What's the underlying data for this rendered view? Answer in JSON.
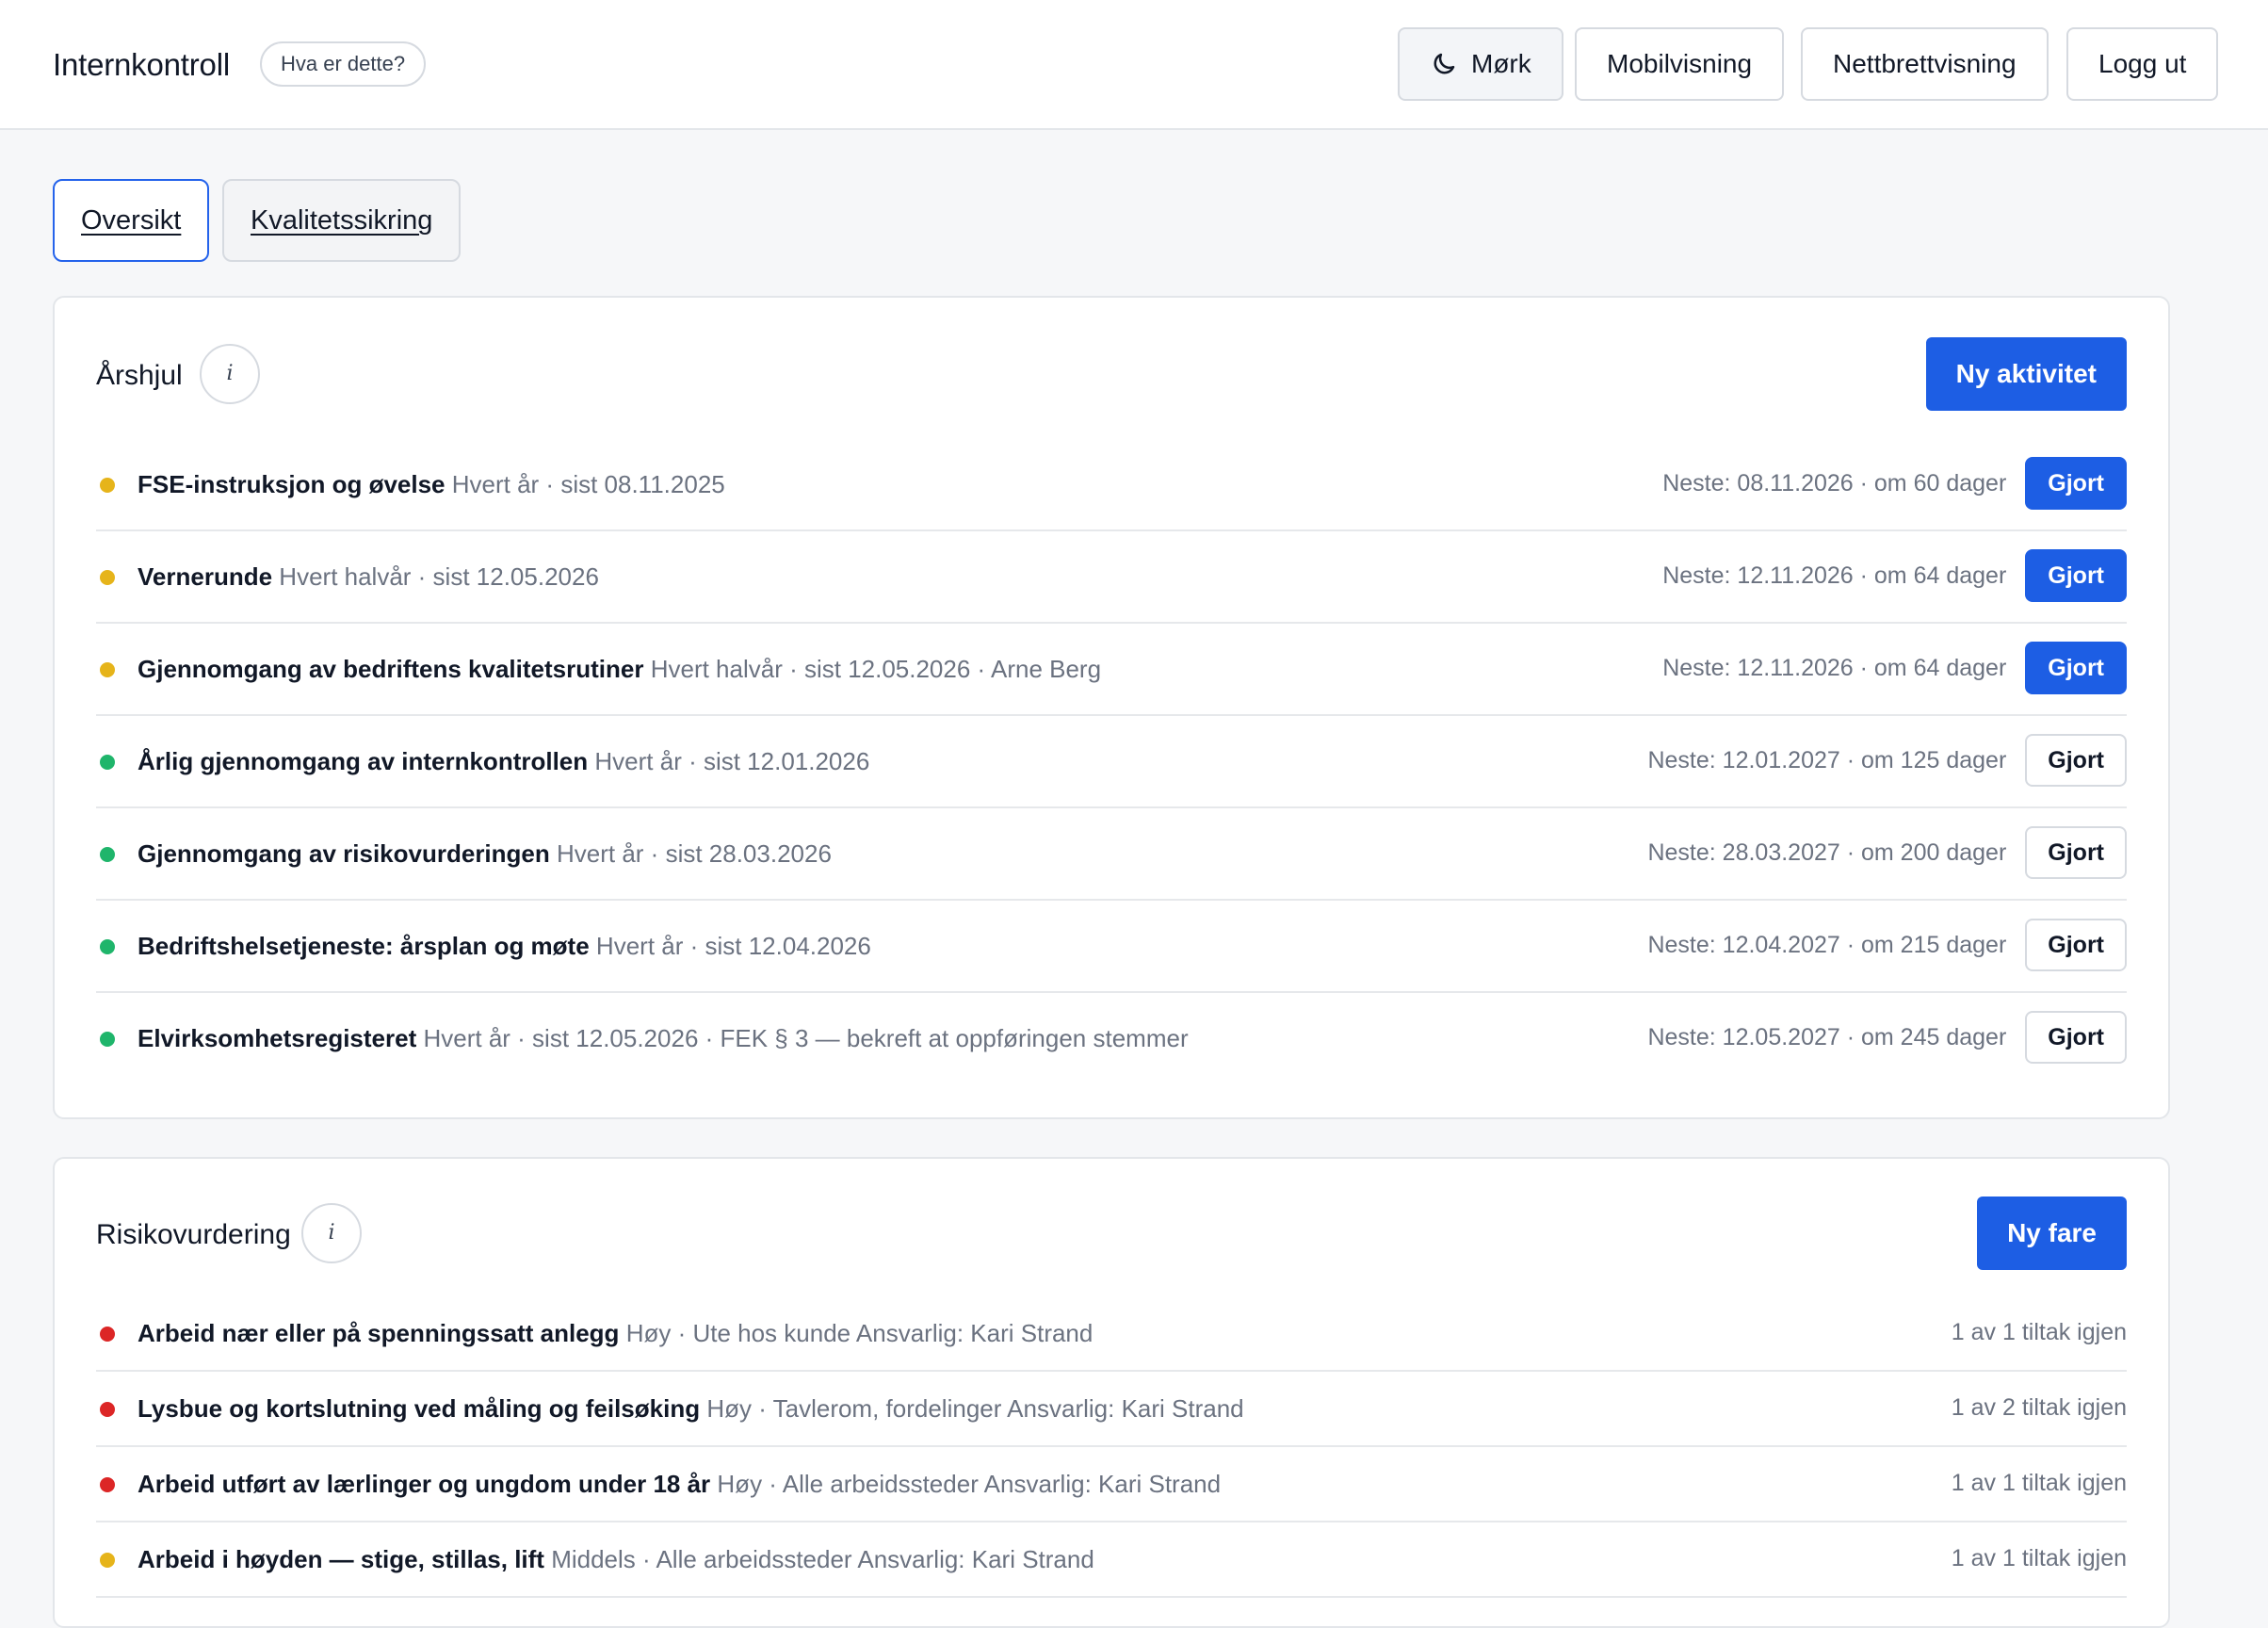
{
  "header": {
    "brand": "Internkontroll",
    "help_label": "Hva er dette?",
    "dark_label": "Mørk",
    "mobile_label": "Mobilvisning",
    "tablet_label": "Nettbrettvisning",
    "logout_label": "Logg ut"
  },
  "tabs": [
    {
      "label": "Oversikt",
      "active": true
    },
    {
      "label": "Kvalitetssikring",
      "active": false
    }
  ],
  "colors": {
    "accent": "#1d5ee4",
    "status_yellow": "#e6b41a",
    "status_green": "#1fb56b",
    "status_red": "#dc2626"
  },
  "arshjul": {
    "title": "Årshjul",
    "info_label": "i",
    "new_label": "Ny aktivitet",
    "rows": [
      {
        "status": "yellow",
        "title": "FSE-instruksjon og øvelse",
        "meta": "Hvert år · sist 08.11.2025",
        "next": "Neste: 08.11.2026 · om 60 dager",
        "done_label": "Gjort",
        "primary": true
      },
      {
        "status": "yellow",
        "title": "Vernerunde",
        "meta": "Hvert halvår · sist 12.05.2026",
        "next": "Neste: 12.11.2026 · om 64 dager",
        "done_label": "Gjort",
        "primary": true
      },
      {
        "status": "yellow",
        "title": "Gjennomgang av bedriftens kvalitetsrutiner",
        "meta": "Hvert halvår · sist 12.05.2026 · Arne Berg",
        "next": "Neste: 12.11.2026 · om 64 dager",
        "done_label": "Gjort",
        "primary": true
      },
      {
        "status": "green",
        "title": "Årlig gjennomgang av internkontrollen",
        "meta": "Hvert år · sist 12.01.2026",
        "next": "Neste: 12.01.2027 · om 125 dager",
        "done_label": "Gjort",
        "primary": false
      },
      {
        "status": "green",
        "title": "Gjennomgang av risikovurderingen",
        "meta": "Hvert år · sist 28.03.2026",
        "next": "Neste: 28.03.2027 · om 200 dager",
        "done_label": "Gjort",
        "primary": false
      },
      {
        "status": "green",
        "title": "Bedriftshelsetjeneste: årsplan og møte",
        "meta": "Hvert år · sist 12.04.2026",
        "next": "Neste: 12.04.2027 · om 215 dager",
        "done_label": "Gjort",
        "primary": false
      },
      {
        "status": "green",
        "title": "Elvirksomhetsregisteret",
        "meta": "Hvert år · sist 12.05.2026 · FEK § 3 — bekreft at oppføringen stemmer",
        "next": "Neste: 12.05.2027 · om 245 dager",
        "done_label": "Gjort",
        "primary": false
      }
    ]
  },
  "risiko": {
    "title": "Risikovurdering",
    "info_label": "i",
    "new_label": "Ny fare",
    "rows": [
      {
        "status": "red",
        "title": "Arbeid nær eller på spenningssatt anlegg",
        "meta": "Høy · Ute hos kunde Ansvarlig: Kari Strand",
        "right": "1 av 1 tiltak igjen"
      },
      {
        "status": "red",
        "title": "Lysbue og kortslutning ved måling og feilsøking",
        "meta": "Høy · Tavlerom, fordelinger Ansvarlig: Kari Strand",
        "right": "1 av 2 tiltak igjen"
      },
      {
        "status": "red",
        "title": "Arbeid utført av lærlinger og ungdom under 18 år",
        "meta": "Høy · Alle arbeidssteder Ansvarlig: Kari Strand",
        "right": "1 av 1 tiltak igjen"
      },
      {
        "status": "yellow",
        "title": "Arbeid i høyden — stige, stillas, lift",
        "meta": "Middels · Alle arbeidssteder Ansvarlig: Kari Strand",
        "right": "1 av 1 tiltak igjen"
      }
    ]
  }
}
